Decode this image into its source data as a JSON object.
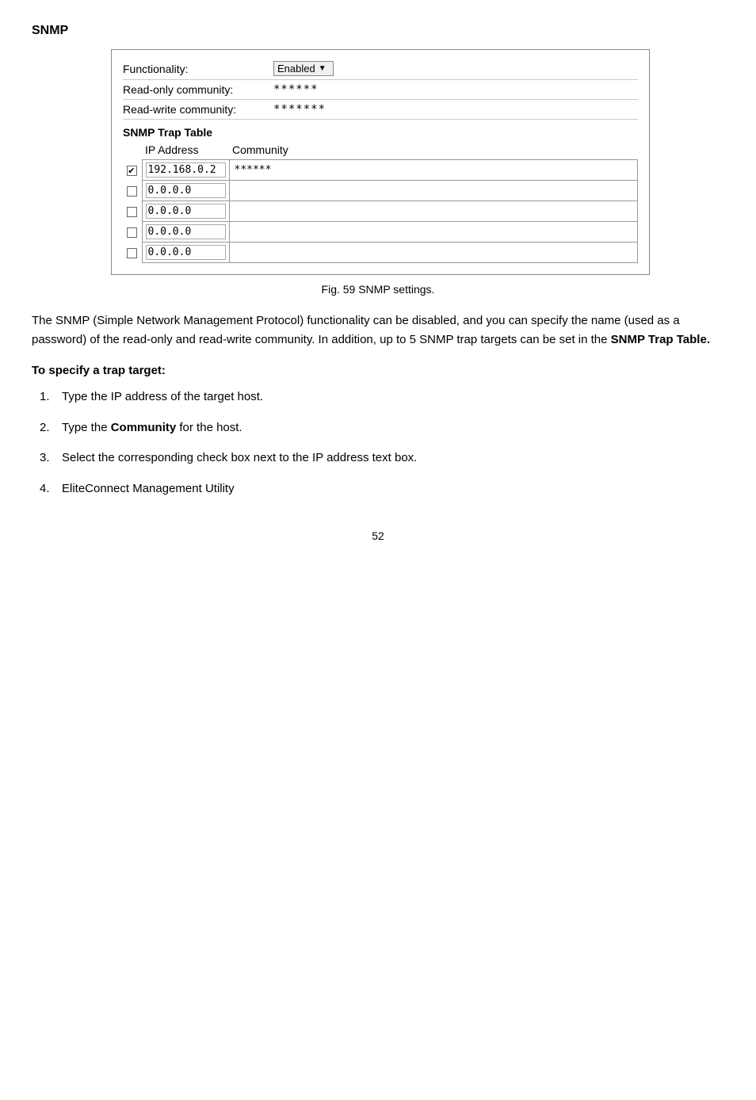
{
  "page": {
    "title": "SNMP",
    "figure_caption": "Fig. 59 SNMP settings.",
    "page_number": "52"
  },
  "snmp_form": {
    "functionality_label": "Functionality:",
    "functionality_value": "Enabled",
    "read_only_label": "Read-only community:",
    "read_only_value": "******",
    "read_write_label": "Read-write community:",
    "read_write_value": "*******",
    "trap_table_title": "SNMP Trap Table",
    "ip_col_header": "IP Address",
    "community_col_header": "Community",
    "trap_rows": [
      {
        "checked": true,
        "ip": "192.168.0.2",
        "community": "******"
      },
      {
        "checked": false,
        "ip": "0.0.0.0",
        "community": ""
      },
      {
        "checked": false,
        "ip": "0.0.0.0",
        "community": ""
      },
      {
        "checked": false,
        "ip": "0.0.0.0",
        "community": ""
      },
      {
        "checked": false,
        "ip": "0.0.0.0",
        "community": ""
      }
    ]
  },
  "body": {
    "paragraph": "The SNMP (Simple Network Management Protocol) functionality can be disabled, and you can specify the name (used as a password) of the read-only and read-write community. In addition, up to 5 SNMP trap targets can be set in the",
    "paragraph_bold": "SNMP Trap Table.",
    "section_heading": "To specify a trap target:",
    "steps": [
      {
        "num": "1.",
        "text": "Type the IP address of the target host."
      },
      {
        "num": "2.",
        "text_before": "Type the ",
        "bold": "Community",
        "text_after": " for the host."
      },
      {
        "num": "3.",
        "text": "Select the corresponding check box next to the IP address text box."
      },
      {
        "num": "4.",
        "text": "EliteConnect Management Utility"
      }
    ]
  }
}
